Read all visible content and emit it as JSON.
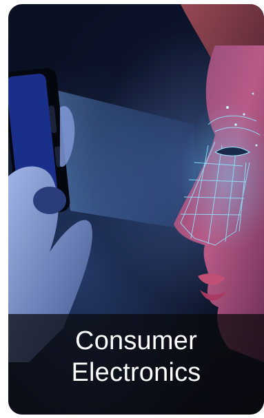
{
  "card": {
    "title_line1": "Consumer",
    "title_line2": "Electronics",
    "image_subject": "face-recognition-phone-scan"
  },
  "colors": {
    "background": "#0b1226",
    "scan_glow": "#5fd4ff",
    "caption_text": "#ffffff",
    "caption_band": "#0a0a0c"
  }
}
